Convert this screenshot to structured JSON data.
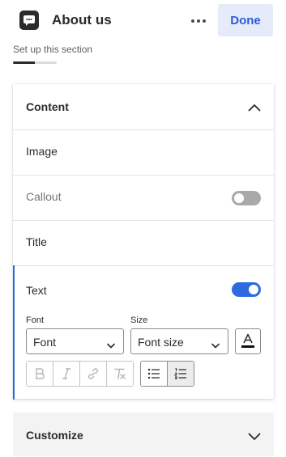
{
  "header": {
    "title": "About us",
    "app_icon": "chat-bubble-icon",
    "more_icon": "more-horizontal-icon",
    "done_label": "Done",
    "setup_text": "Set up this section",
    "progress": 0.5
  },
  "content": {
    "title": "Content",
    "collapse_icon": "chevron-up-icon",
    "rows": {
      "image": {
        "label": "Image"
      },
      "callout": {
        "label": "Callout",
        "enabled": false
      },
      "title": {
        "label": "Title"
      },
      "text": {
        "label": "Text",
        "enabled": true
      }
    },
    "text_settings": {
      "font_label": "Font",
      "font_value": "Font",
      "size_label": "Size",
      "size_value": "Font size",
      "color_icon": "text-color-icon",
      "format_buttons": [
        "bold-icon",
        "italic-icon",
        "link-icon",
        "clear-format-icon"
      ],
      "list_buttons": [
        "bullet-list-icon",
        "numbered-list-icon"
      ]
    }
  },
  "customize": {
    "title": "Customize",
    "expand_icon": "chevron-down-icon"
  },
  "colors": {
    "accent": "#2d6ae0",
    "done_bg": "#e6ebfa",
    "done_text": "#2d5ae0"
  }
}
